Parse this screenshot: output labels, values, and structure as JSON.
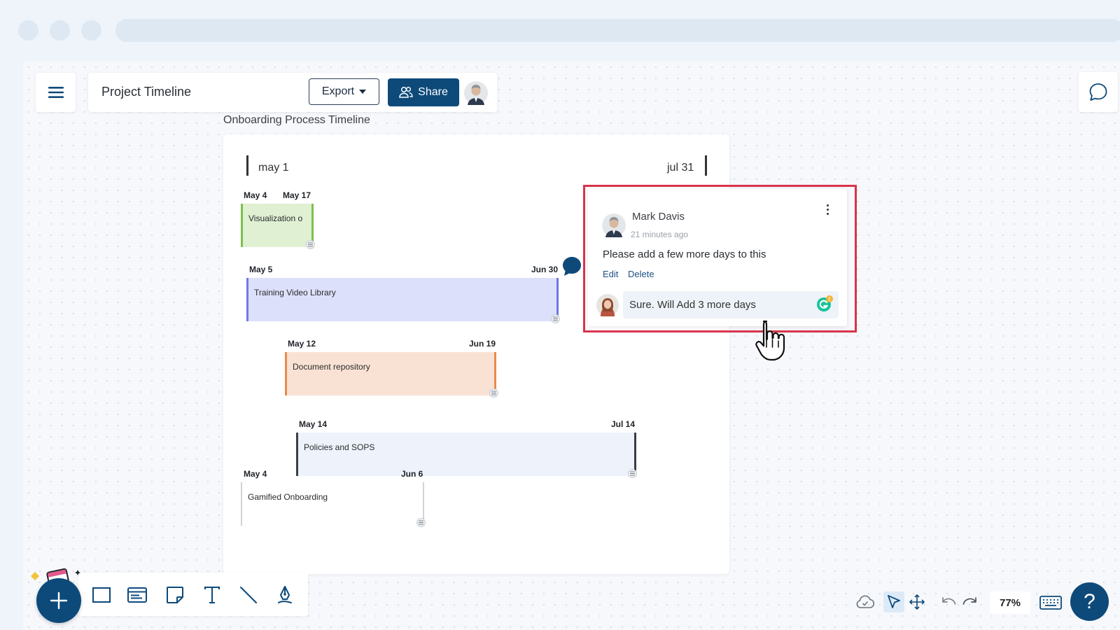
{
  "header": {
    "title": "Project Timeline",
    "export_label": "Export",
    "share_label": "Share"
  },
  "frame": {
    "title": "Onboarding Process Timeline",
    "range_start": "may 1",
    "range_end": "jul 31"
  },
  "bars": [
    {
      "label": "Visualization o",
      "start": "May 4",
      "end": "May 17",
      "fill": "#dff0d3",
      "accent": "#7cc04d"
    },
    {
      "label": "Training Video Library",
      "start": "May 5",
      "end": "Jun 30",
      "fill": "#dde0fb",
      "accent": "#6f78e6"
    },
    {
      "label": "Document repository",
      "start": "May 12",
      "end": "Jun 19",
      "fill": "#f9e2d4",
      "accent": "#e98b4b"
    },
    {
      "label": "Policies and SOPS",
      "start": "May 14",
      "end": "Jul 14",
      "fill": "#edf2fb",
      "accent": "#3a3f46"
    },
    {
      "label": "Gamified Onboarding",
      "start": "May 4",
      "end": "Jun 6",
      "fill": "#ffffff",
      "accent": "#d0d4d9"
    }
  ],
  "comment": {
    "author": "Mark Davis",
    "time": "21 minutes ago",
    "body": "Please add a few more days to this",
    "edit_label": "Edit",
    "delete_label": "Delete",
    "reply_value": "Sure. Will Add 3 more days",
    "grammarly_count": "2"
  },
  "zoom": "77%",
  "help_label": "?",
  "icons": [
    "menu-icon",
    "user-group-icon",
    "comment-icon",
    "note-icon",
    "plus-icon",
    "rectangle-icon",
    "card-icon",
    "sticky-note-icon",
    "text-icon",
    "line-icon",
    "pen-icon",
    "cloud-icon",
    "select-pointer-icon",
    "move-icon",
    "undo-icon",
    "redo-icon",
    "keyboard-icon",
    "help-icon"
  ],
  "colors": {
    "primary": "#0d4a7a",
    "highlight": "#d8344c"
  }
}
